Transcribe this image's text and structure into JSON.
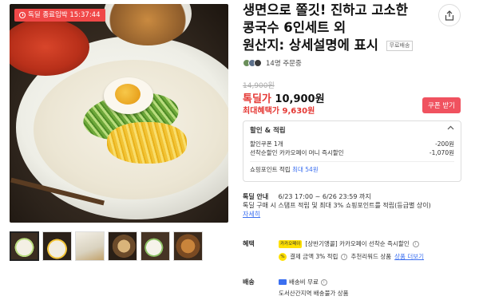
{
  "image": {
    "timer_badge": "독딜 종료임박 15:37:44"
  },
  "thumbnails": [
    {
      "name": "thumb-1"
    },
    {
      "name": "thumb-2"
    },
    {
      "name": "thumb-3"
    },
    {
      "name": "thumb-4"
    },
    {
      "name": "thumb-5"
    },
    {
      "name": "thumb-6"
    }
  ],
  "product": {
    "title_line1": "생면으로 쫄깃! 진하고 고소한",
    "title_line2": "콩국수 6인세트 외",
    "title_line3": "원산지: 상세설명에 표시",
    "shipping_tag": "무료배송",
    "buyers": "14명 주문중"
  },
  "price": {
    "original": "14,900원",
    "deal_label": "톡딜가",
    "deal_value": "10,900원",
    "max_label": "최대혜택가",
    "max_value": "9,630원",
    "coupon_button": "쿠폰 받기"
  },
  "discount": {
    "header": "할인 & 적립",
    "rows": [
      {
        "label": "할인쿠폰 1개",
        "value": "-200원"
      },
      {
        "label": "선착순할인  카카오페이 머니 즉시할인",
        "value": "-1,070원"
      }
    ],
    "points_label": "쇼핑포인트 적립",
    "points_value": "최대 54원"
  },
  "deal": {
    "key": "톡딜 안내",
    "period": "6/23 17:00 ~ 6/26 23:59 까지",
    "desc": "톡딜 구매 시 스탬프 적립 및 최대 3% 쇼핑포인트를 적립(등급별 상이)",
    "more": "자세히"
  },
  "benefit": {
    "key": "혜택",
    "chip1": "카카오페이",
    "line1": "[상반기앵콜] 카카오페이 선착순 즉시할인",
    "chip2": "%",
    "line2": "결제 금액 3% 적립",
    "line2_suffix": "추천리워드 상품",
    "more": "상품 더보기"
  },
  "shipping": {
    "key": "배송",
    "line1": "배송비 무료",
    "line2": "도서산간지역 배송불가 상품"
  },
  "colors": {
    "accent_red": "#e53935",
    "coupon_bg": "#f0525f",
    "link_blue": "#3b6ff0",
    "kakao_yellow": "#ffe000"
  }
}
